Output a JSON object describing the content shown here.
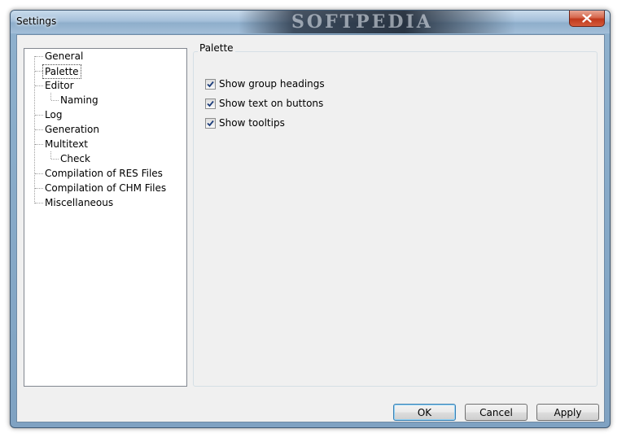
{
  "window": {
    "title": "Settings",
    "watermark": "SOFTPEDIA"
  },
  "tree": {
    "items": [
      {
        "label": "General",
        "level": 0
      },
      {
        "label": "Palette",
        "level": 0,
        "selected": true
      },
      {
        "label": "Editor",
        "level": 0
      },
      {
        "label": "Naming",
        "level": 1
      },
      {
        "label": "Log",
        "level": 0
      },
      {
        "label": "Generation",
        "level": 0
      },
      {
        "label": "Multitext",
        "level": 0
      },
      {
        "label": "Check",
        "level": 1
      },
      {
        "label": "Compilation of RES Files",
        "level": 0
      },
      {
        "label": "Compilation of CHM Files",
        "level": 0
      },
      {
        "label": "Miscellaneous",
        "level": 0
      }
    ]
  },
  "panel": {
    "title": "Palette",
    "options": [
      {
        "label": "Show group headings",
        "checked": true
      },
      {
        "label": "Show text on buttons",
        "checked": true
      },
      {
        "label": "Show tooltips",
        "checked": true
      }
    ]
  },
  "buttons": {
    "ok": "OK",
    "cancel": "Cancel",
    "apply": "Apply"
  },
  "colors": {
    "selection_border": "#4a4a4a",
    "close_button": "#c0391c",
    "check_mark": "#1d3d7a"
  }
}
